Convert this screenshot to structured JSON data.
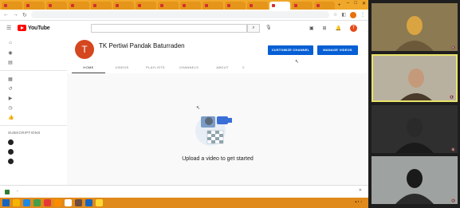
{
  "browser": {
    "tabs": [
      "",
      "",
      "",
      "",
      "",
      "",
      "",
      "",
      "",
      "",
      "",
      "",
      "",
      "",
      ""
    ],
    "active_tab_index": 12,
    "address": "",
    "new_tab_symbol": "+",
    "window_controls": [
      "–",
      "□",
      "✕"
    ]
  },
  "youtube": {
    "logo_word": "YouTube",
    "search_placeholder": "",
    "avatar_letter": "T",
    "sidebar": {
      "items": [
        {
          "icon": "home-icon",
          "glyph": "⌂",
          "label": ""
        },
        {
          "icon": "explore-icon",
          "glyph": "◉",
          "label": ""
        },
        {
          "icon": "subscriptions-icon",
          "glyph": "▤",
          "label": ""
        },
        {
          "icon": "library-icon",
          "glyph": "▦",
          "label": ""
        },
        {
          "icon": "history-icon",
          "glyph": "↺",
          "label": ""
        },
        {
          "icon": "your-videos-icon",
          "glyph": "▶",
          "label": ""
        },
        {
          "icon": "watch-later-icon",
          "glyph": "◷",
          "label": ""
        },
        {
          "icon": "liked-videos-icon",
          "glyph": "👍",
          "label": ""
        }
      ],
      "subscriptions_heading": "SUBSCRIPTIONS",
      "subscriptions": [
        {
          "label": ""
        },
        {
          "label": ""
        },
        {
          "label": ""
        }
      ]
    },
    "channel": {
      "avatar_letter": "T",
      "name": "TK Pertiwi Pandak Baturraden",
      "subscribers": "",
      "customize_button": "CUSTOMIZE CHANNEL",
      "manage_button": "MANAGE VIDEOS",
      "tabs": [
        "HOME",
        "VIDEOS",
        "PLAYLISTS",
        "CHANNELS",
        "ABOUT"
      ],
      "active_tab": 0
    },
    "empty_state": {
      "title": "Upload a video to get started",
      "description": ""
    }
  },
  "download_bar": {
    "file_name": "",
    "show_all": "",
    "close_glyph": "✕"
  },
  "taskbar": {
    "apps": [
      "#f4b400",
      "#1e88e5",
      "#43a047",
      "#e53935",
      "#fb8c00",
      "#ffffff",
      "#6d4c41",
      "#1565c0",
      "#fdd835"
    ],
    "clock_time": "",
    "clock_date": ""
  },
  "participants": [
    {
      "name": "",
      "bg": "#8b7a52",
      "selected": false
    },
    {
      "name": "",
      "bg": "#b9b1a0",
      "selected": true
    },
    {
      "name": "",
      "bg": "#2f2f2f",
      "selected": false
    },
    {
      "name": "",
      "bg": "#9ea2a0",
      "selected": false
    }
  ],
  "colors": {
    "accent_blue": "#065fd4",
    "youtube_red": "#ff0000",
    "taskbar_orange": "#e08a1c",
    "selected_tile_border": "#e9e36a"
  }
}
